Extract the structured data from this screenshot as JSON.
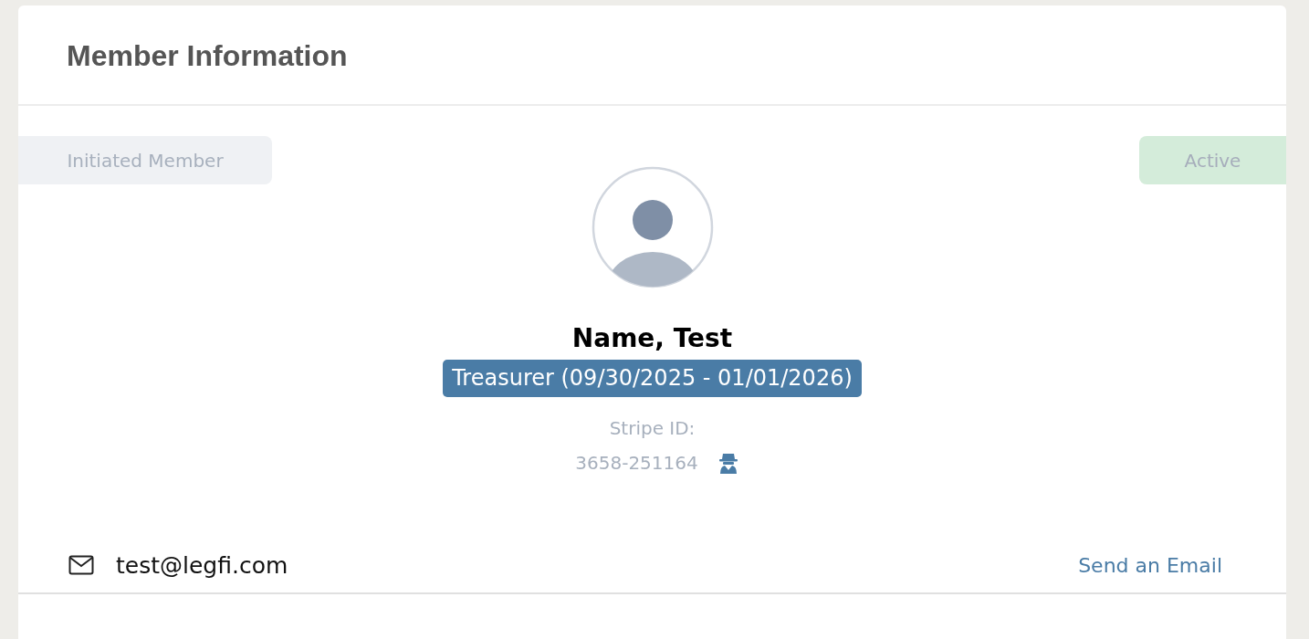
{
  "card": {
    "title": "Member Information"
  },
  "member_type_badge": "Initiated Member",
  "status_badge": "Active",
  "profile": {
    "name": "Name, Test",
    "role": "Treasurer (09/30/2025 - 01/01/2026)",
    "stripe_id_label": "Stripe ID:",
    "stripe_id": "3658-251164"
  },
  "contact": {
    "email": "test@legfi.com",
    "action": "Send an Email"
  }
}
